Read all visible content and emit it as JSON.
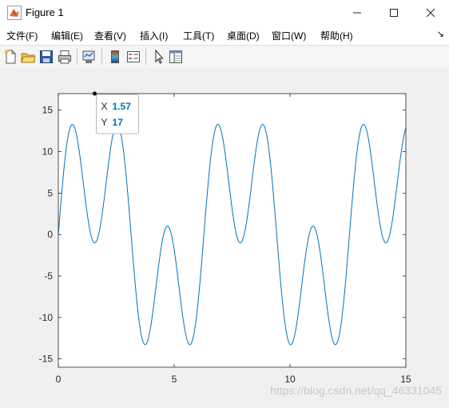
{
  "window": {
    "title": "Figure 1"
  },
  "menu": [
    "文件(F)",
    "编辑(E)",
    "查看(V)",
    "插入(I)",
    "工具(T)",
    "桌面(D)",
    "窗口(W)",
    "帮助(H)"
  ],
  "colors": {
    "line": "#0072bd",
    "datatip_value": "#0072bd"
  },
  "chart_data": {
    "type": "line",
    "title": "",
    "xlabel": "",
    "ylabel": "",
    "xlim": [
      0,
      15
    ],
    "ylim": [
      -16,
      17
    ],
    "xticks": [
      "0",
      "5",
      "10",
      "15"
    ],
    "yticks": [
      "15",
      "10",
      "5",
      "0",
      "-5",
      "-10",
      "-15"
    ],
    "series": [
      {
        "function": "8*sin(3x)*... peaks up to 17 (x from 0 to 15, ~1500 samples)",
        "x_start": 0,
        "x_end": 15
      }
    ],
    "datatip": {
      "x_label": "X",
      "x_value": "1.57",
      "y_label": "Y",
      "y_value": "17"
    }
  },
  "watermark": "https://blog.csdn.net/qq_46331045"
}
